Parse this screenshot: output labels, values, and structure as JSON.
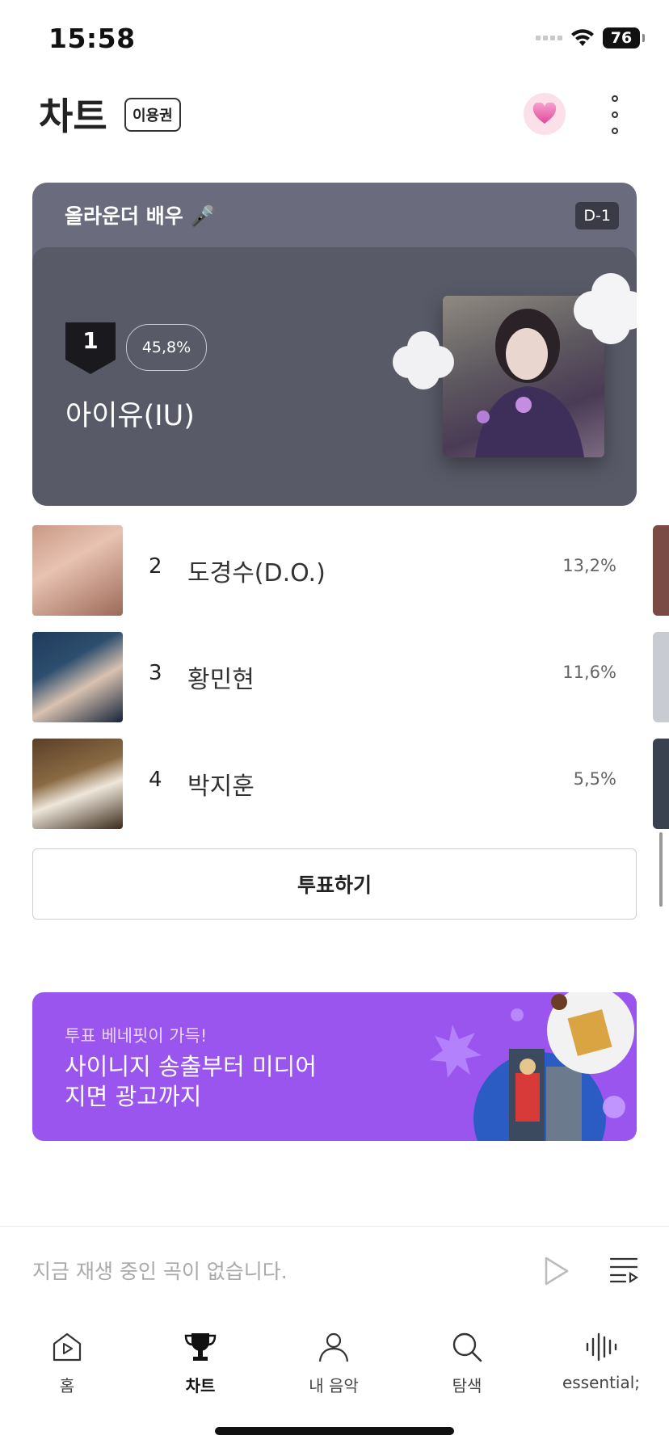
{
  "status_bar": {
    "time": "15:58",
    "battery": "76"
  },
  "header": {
    "title": "차트",
    "pass_badge": "이용권"
  },
  "vote_card": {
    "title": "올라운더 배우 🎤",
    "dday": "D-1",
    "leader": {
      "rank": "1",
      "percent": "45,8%",
      "name": "아이유(IU)"
    }
  },
  "ranking": [
    {
      "rank": "2",
      "name": "도경수(D.O.)",
      "percent": "13,2%"
    },
    {
      "rank": "3",
      "name": "황민현",
      "percent": "11,6%"
    },
    {
      "rank": "4",
      "name": "박지훈",
      "percent": "5,5%"
    }
  ],
  "vote_button": "투표하기",
  "promo": {
    "subtitle": "투표 베네핏이 가득!",
    "line1": "사이니지 송출부터 미디어",
    "line2": "지면 광고까지"
  },
  "player": {
    "empty_text": "지금 재생 중인 곡이 없습니다."
  },
  "tabs": [
    {
      "label": "홈",
      "icon": "home-play-icon",
      "active": false
    },
    {
      "label": "차트",
      "icon": "trophy-icon",
      "active": true
    },
    {
      "label": "내 음악",
      "icon": "person-icon",
      "active": false
    },
    {
      "label": "탐색",
      "icon": "search-icon",
      "active": false
    },
    {
      "label": "essential;",
      "icon": "soundwave-icon",
      "active": false
    }
  ],
  "colors": {
    "promo_bg": "#9a55ef",
    "card_bg": "#6a6b7c",
    "card_inner": "#595a68",
    "heart_bg": "#fbe0ea"
  }
}
